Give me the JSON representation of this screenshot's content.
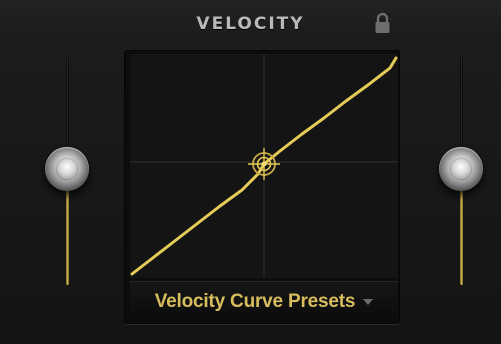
{
  "panel": {
    "title": "VELOCITY",
    "icons": {
      "lock": "lock-icon",
      "crosshair": "crosshair-handle-icon",
      "dropdown": "triangle-down-icon"
    }
  },
  "preset_menu": {
    "label": "Velocity Curve Presets"
  },
  "colors": {
    "accent": "#d7bd5c",
    "curve": "#e5cb57",
    "grid": "#2c3330",
    "background": "#181818"
  },
  "curve": {
    "type": "linear",
    "midpoint_handle": [
      0.5,
      0.5
    ]
  },
  "sliders": {
    "left": {
      "level": 0.47
    },
    "right": {
      "level": 0.47
    }
  }
}
